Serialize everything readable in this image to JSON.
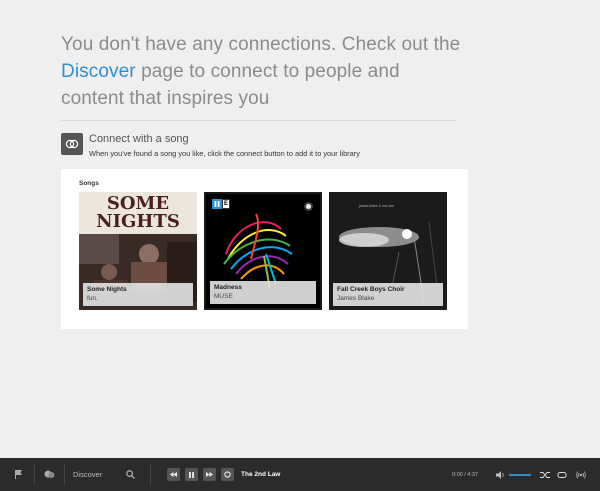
{
  "message": {
    "before": "You don't have any connections. Check out the ",
    "link": "Discover",
    "after": " page to connect to people and content that inspires you"
  },
  "tip": {
    "title": "Connect with a song",
    "subtitle": "When you've found a song you like, click the connect button to add it to your library"
  },
  "songs": {
    "label": "Songs",
    "items": [
      {
        "title": "Some Nights",
        "artist": "fun.",
        "art_text_1": "SOME",
        "art_text_2": "NIGHTS"
      },
      {
        "title": "Madness",
        "artist": "MUSE",
        "badge": "E"
      },
      {
        "title": "Fall Creek Boys Choir",
        "artist": "James Blake",
        "art_caption": "james blake & bon iver"
      }
    ]
  },
  "player": {
    "discover_label": "Discover",
    "track": "The 2nd Law",
    "time": "0:00 / 4:37"
  },
  "colors": {
    "accent": "#2f8fd1",
    "bar": "#2b2b2b"
  }
}
